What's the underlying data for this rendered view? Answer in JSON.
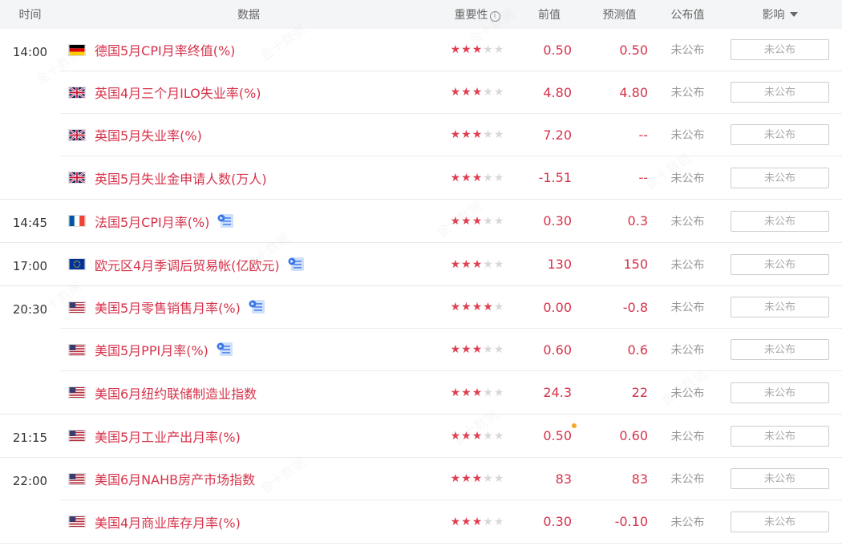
{
  "header": {
    "time": "时间",
    "data": "数据",
    "importance": "重要性",
    "previous": "前值",
    "forecast": "预测值",
    "actual": "公布值",
    "effect": "影响"
  },
  "watermark": "金十数据",
  "groups": [
    {
      "time": "14:00",
      "rows": [
        {
          "flag": "DE",
          "title": "德国5月CPI月率终值(%)",
          "stars": 3,
          "prev": "0.50",
          "forecast": "0.50",
          "actual": "未公布",
          "effect": "未公布",
          "doc": false,
          "dot": false
        },
        {
          "flag": "GB",
          "title": "英国4月三个月ILO失业率(%)",
          "stars": 3,
          "prev": "4.80",
          "forecast": "4.80",
          "actual": "未公布",
          "effect": "未公布",
          "doc": false,
          "dot": false
        },
        {
          "flag": "GB",
          "title": "英国5月失业率(%)",
          "stars": 3,
          "prev": "7.20",
          "forecast": "--",
          "actual": "未公布",
          "effect": "未公布",
          "doc": false,
          "dot": false
        },
        {
          "flag": "GB",
          "title": "英国5月失业金申请人数(万人)",
          "stars": 3,
          "prev": "-1.51",
          "forecast": "--",
          "actual": "未公布",
          "effect": "未公布",
          "doc": false,
          "dot": false
        }
      ]
    },
    {
      "time": "14:45",
      "rows": [
        {
          "flag": "FR",
          "title": "法国5月CPI月率(%)",
          "stars": 3,
          "prev": "0.30",
          "forecast": "0.3",
          "actual": "未公布",
          "effect": "未公布",
          "doc": true,
          "dot": false
        }
      ]
    },
    {
      "time": "17:00",
      "rows": [
        {
          "flag": "EU",
          "title": "欧元区4月季调后贸易帐(亿欧元)",
          "stars": 3,
          "prev": "130",
          "forecast": "150",
          "actual": "未公布",
          "effect": "未公布",
          "doc": true,
          "dot": false
        }
      ]
    },
    {
      "time": "20:30",
      "rows": [
        {
          "flag": "US",
          "title": "美国5月零售销售月率(%)",
          "stars": 4,
          "prev": "0.00",
          "forecast": "-0.8",
          "actual": "未公布",
          "effect": "未公布",
          "doc": true,
          "dot": false
        },
        {
          "flag": "US",
          "title": "美国5月PPI月率(%)",
          "stars": 3,
          "prev": "0.60",
          "forecast": "0.6",
          "actual": "未公布",
          "effect": "未公布",
          "doc": true,
          "dot": false
        },
        {
          "flag": "US",
          "title": "美国6月纽约联储制造业指数",
          "stars": 3,
          "prev": "24.3",
          "forecast": "22",
          "actual": "未公布",
          "effect": "未公布",
          "doc": false,
          "dot": false
        }
      ]
    },
    {
      "time": "21:15",
      "rows": [
        {
          "flag": "US",
          "title": "美国5月工业产出月率(%)",
          "stars": 3,
          "prev": "0.50",
          "forecast": "0.60",
          "actual": "未公布",
          "effect": "未公布",
          "doc": false,
          "dot": true
        }
      ]
    },
    {
      "time": "22:00",
      "rows": [
        {
          "flag": "US",
          "title": "美国6月NAHB房产市场指数",
          "stars": 3,
          "prev": "83",
          "forecast": "83",
          "actual": "未公布",
          "effect": "未公布",
          "doc": false,
          "dot": false
        },
        {
          "flag": "US",
          "title": "美国4月商业库存月率(%)",
          "stars": 3,
          "prev": "0.30",
          "forecast": "-0.10",
          "actual": "未公布",
          "effect": "未公布",
          "doc": false,
          "dot": false
        }
      ]
    }
  ]
}
